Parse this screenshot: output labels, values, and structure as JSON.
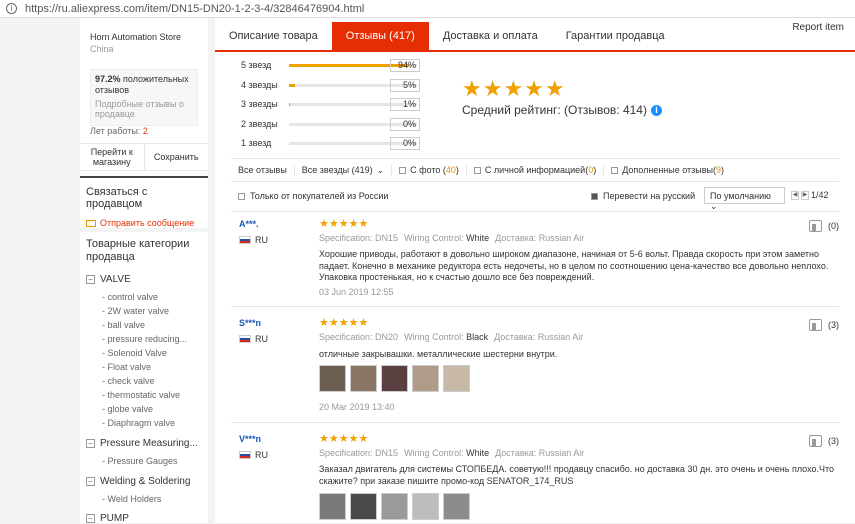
{
  "browser": {
    "url": "https://ru.aliexpress.com/item/DN15-DN20-1-2-3-4/32846476904.html"
  },
  "store": {
    "name": "Horn Automation Store",
    "country": "China",
    "positive_pct": "97.2%",
    "positive_text": "положительных отзывов",
    "similar": "Подробные отзывы о продавце",
    "years_label": "Лет работы:",
    "years_value": "2",
    "go_store": "Перейти к магазину",
    "save": "Сохранить"
  },
  "contact": {
    "title": "Связаться с продавцом",
    "message": "Отправить сообщение"
  },
  "categories": {
    "title": "Товарные категории продавца",
    "groups": [
      {
        "name": "VALVE",
        "items": [
          "- control valve",
          "- 2W water valve",
          "- ball valve",
          "- pressure reducing...",
          "- Solenoid Valve",
          "- Float valve",
          "- check valve",
          "- thermostatic valve",
          "- globe valve",
          "- Diaphragm valve"
        ]
      },
      {
        "name": "Pressure Measuring...",
        "items": [
          "- Pressure Gauges"
        ]
      },
      {
        "name": "Welding & Soldering",
        "items": [
          "- Weld Holders"
        ]
      },
      {
        "name": "PUMP",
        "items": []
      }
    ]
  },
  "tabs": [
    "Описание товара",
    "Отзывы (417)",
    "Доставка и оплата",
    "Гарантии продавца"
  ],
  "report": "Report item",
  "ratings": [
    {
      "label": "5 звезд",
      "pct": "94%",
      "frac": 0.94
    },
    {
      "label": "4 звезды",
      "pct": "5%",
      "frac": 0.05
    },
    {
      "label": "3 звезды",
      "pct": "1%",
      "frac": 0.01
    },
    {
      "label": "2 звезды",
      "pct": "0%",
      "frac": 0
    },
    {
      "label": "1 звезд",
      "pct": "0%",
      "frac": 0
    }
  ],
  "avg": {
    "stars": "★★★★★",
    "text": "Средний рейтинг:  (Отзывов: 414)",
    "info": "i"
  },
  "filters": {
    "all": "Все отзывы",
    "all_stars": "Все звезды (419)",
    "photo": "С фото (",
    "photo_count": "40",
    "personal": "С личной информацией(",
    "personal_count": "0",
    "extra": "Дополненные отзывы(",
    "extra_count": "9",
    "close": ")",
    "only_ru": "Только от покупателей из России",
    "translate": "Перевести на русский",
    "sort": "По умолчанию",
    "page": "1/42"
  },
  "reviews": [
    {
      "user": "A***.",
      "country": "RU",
      "stars": "★★★★★",
      "spec_label": "Specification:",
      "spec": "DN15",
      "wiring_label": "Wiring Control:",
      "wiring": "White",
      "ship_label": "Доставка:",
      "ship": "Russian Air",
      "text": "Хорошие приводы, работают в довольно широком диапазоне, начиная от 5-6 вольт. Правда скорость при этом заметно падает. Конечно в механике редуктора есть недочеты, но в целом по соотношению цена-качество все довольно неплохо. Упаковка простенькая, но к счастью дошло все без повреждений.",
      "date": "03 Jun 2019 12:55",
      "likes": "(0)",
      "photos": []
    },
    {
      "user": "S***n",
      "country": "RU",
      "stars": "★★★★★",
      "spec_label": "Specification:",
      "spec": "DN20",
      "wiring_label": "Wiring Control:",
      "wiring": "Black",
      "ship_label": "Доставка:",
      "ship": "Russian Air",
      "text": "отличные закрывашки. металлические шестерни внутри.",
      "date": "20 Mar 2019 13:40",
      "likes": "(3)",
      "photos": [
        "#6b5d4f",
        "#8a7665",
        "#5a4040",
        "#b09a88",
        "#c8b8a8"
      ]
    },
    {
      "user": "V***n",
      "country": "RU",
      "stars": "★★★★★",
      "spec_label": "Specification:",
      "spec": "DN15",
      "wiring_label": "Wiring Control:",
      "wiring": "White",
      "ship_label": "Доставка:",
      "ship": "Russian Air",
      "text": "Заказал двигатель для системы СТОПБЕДА. советую!!! продавцу спасибо. но доставка 30 дн. это очень и очень плохо.Что скажите? при заказе пишите промо-код SENATOR_174_RUS",
      "date": "",
      "likes": "(3)",
      "photos": [
        "#7a7a7a",
        "#4a4a4a",
        "#9a9a9a",
        "#bdbdbd",
        "#8c8c8c"
      ]
    }
  ]
}
